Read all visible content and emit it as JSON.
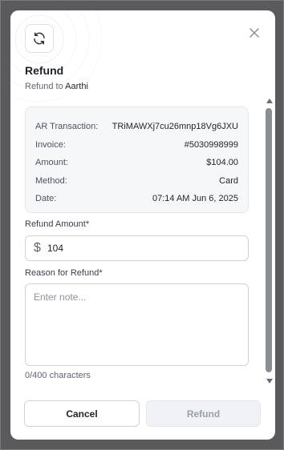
{
  "modal": {
    "title": "Refund",
    "subtitle_prefix": "Refund to ",
    "subtitle_name": "Aarthi"
  },
  "details": [
    {
      "label": "AR Transaction:",
      "value": "TRiMAWXj7cu26mnp18Vg6JXU"
    },
    {
      "label": "Invoice:",
      "value": "#5030998999"
    },
    {
      "label": "Amount:",
      "value": "$104.00"
    },
    {
      "label": "Method:",
      "value": "Card"
    },
    {
      "label": "Date:",
      "value": "07:14 AM Jun 6, 2025"
    }
  ],
  "refund_amount": {
    "label": "Refund Amount*",
    "currency_symbol": "$",
    "value": "104"
  },
  "reason": {
    "label": "Reason for Refund*",
    "placeholder": "Enter note...",
    "char_count": "0/400 characters"
  },
  "buttons": {
    "cancel": "Cancel",
    "refund": "Refund"
  },
  "icons": {
    "header": "refresh-icon",
    "close": "close-icon"
  }
}
